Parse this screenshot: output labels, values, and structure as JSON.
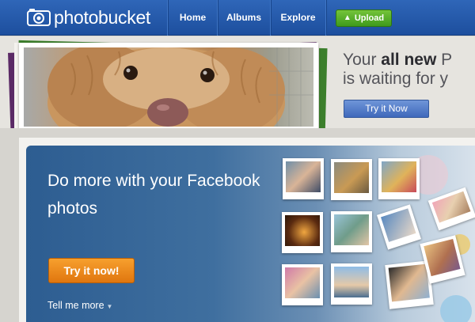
{
  "header": {
    "logo_text": "photobucket",
    "nav": [
      "Home",
      "Albums",
      "Explore"
    ],
    "upload_label": "Upload"
  },
  "hero": {
    "line1_prefix": "Your ",
    "line1_bold": "all new",
    "line1_suffix": " P",
    "line2": "is waiting for y",
    "cta_label": "Try it Now"
  },
  "facebook_promo": {
    "headline": "Do more with your Facebook photos",
    "cta_label": "Try it now!",
    "more_label": "Tell me more"
  },
  "colors": {
    "nav_blue": "#2459a8",
    "upload_green": "#4ea524",
    "hero_button_blue": "#4f79c6",
    "promo_orange": "#ec8618",
    "promo_panel_blue": "#3a6a9a"
  },
  "icons": {
    "logo": "camera-icon",
    "upload": "up-arrow-icon",
    "more": "chevron-down-icon"
  }
}
